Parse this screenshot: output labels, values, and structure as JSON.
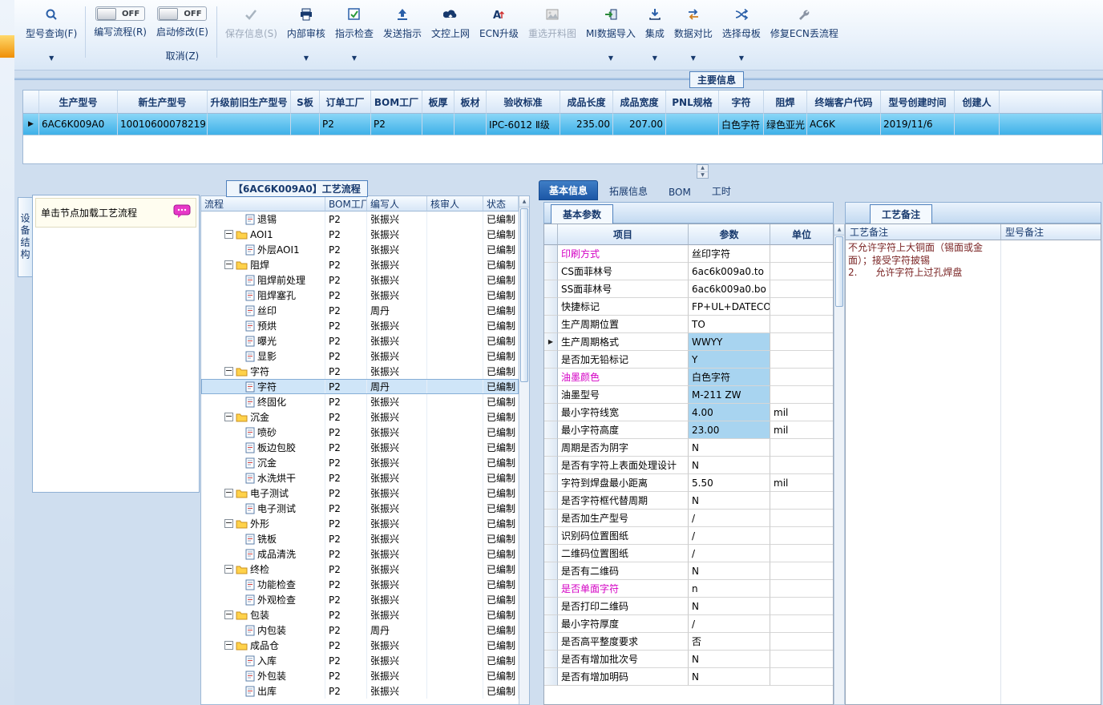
{
  "colors": {
    "accent_blue": "#1c57a6",
    "row_selection_cyan": "#4db6ec",
    "cell_highlight_blue": "#a8d4f0",
    "magenta_label": "#d400c4",
    "header_text_navy": "#17396d",
    "folder_yellow": "#ffd24a"
  },
  "toolbar": {
    "query": {
      "label": "型号查询(F)",
      "icon": "search-icon"
    },
    "write_flow": {
      "toggle": "OFF",
      "label": "编写流程(R)"
    },
    "start_edit": {
      "toggle": "OFF",
      "label": "启动修改(E)",
      "cancel": "取消(Z)"
    },
    "save": {
      "label": "保存信息(S)",
      "icon": "check-icon"
    },
    "audit": {
      "label": "内部审核",
      "icon": "printer-icon"
    },
    "inspect": {
      "label": "指示检查",
      "icon": "checkbox-icon"
    },
    "send": {
      "label": "发送指示",
      "icon": "send-up-icon"
    },
    "doc_upload": {
      "label": "文控上网",
      "icon": "cloud-upload-icon"
    },
    "ecn": {
      "label": "ECN升级",
      "icon": "ecn-upgrade-icon"
    },
    "recut": {
      "label": "重选开料图",
      "icon": "image-icon"
    },
    "mi_import": {
      "label": "MI数据导入",
      "icon": "import-icon"
    },
    "integrate": {
      "label": "集成",
      "icon": "collect-icon"
    },
    "compare": {
      "label": "数据对比",
      "icon": "compare-icon"
    },
    "mother_board": {
      "label": "选择母板",
      "icon": "shuffle-icon"
    },
    "fix_ecn": {
      "label": "修复ECN丢流程",
      "icon": "wrench-icon"
    }
  },
  "main_info": {
    "group_label": "主要信息",
    "headers": [
      "生产型号",
      "新生产型号",
      "升级前旧生产型号",
      "S板",
      "订单工厂",
      "BOM工厂",
      "板厚",
      "板材",
      "验收标准",
      "成品长度",
      "成品宽度",
      "PNL规格",
      "字符",
      "阻焊",
      "终端客户代码",
      "型号创建时间",
      "创建人"
    ],
    "row": {
      "marker": "▶",
      "model": "6AC6K009A0",
      "new_model": "10010600078219",
      "old_model": "",
      "s_version": "",
      "order_factory": "P2",
      "bom_factory": "P2",
      "thickness": "",
      "material": "",
      "standard": "IPC-6012 Ⅱ级",
      "length": "235.00",
      "width": "207.00",
      "pnl": "",
      "silk_color": "白色字符",
      "mask_color": "绿色亚光",
      "customer_code": "AC6K",
      "create_time": "2019/11/6",
      "creator": ""
    }
  },
  "structure_panel": {
    "vertical_tab": "设备结构",
    "hint": "单击节点加载工艺流程"
  },
  "flow": {
    "title": "【6AC6K009A0】工艺流程",
    "headers": [
      "流程",
      "BOM工厂",
      "编写人",
      "核审人",
      "状态"
    ],
    "rows": [
      {
        "name": "退锡",
        "bom": "P2",
        "writer": "张振兴",
        "auditor": "",
        "status": "已编制"
      },
      {
        "name": "AOI1",
        "bom": "P2",
        "writer": "张振兴",
        "auditor": "",
        "status": "已编制",
        "cls": "folder"
      },
      {
        "name": "外层AOI1",
        "bom": "P2",
        "writer": "张振兴",
        "auditor": "",
        "status": "已编制"
      },
      {
        "name": "阻焊",
        "bom": "P2",
        "writer": "张振兴",
        "auditor": "",
        "status": "已编制",
        "cls": "folder"
      },
      {
        "name": "阻焊前处理",
        "bom": "P2",
        "writer": "张振兴",
        "auditor": "",
        "status": "已编制"
      },
      {
        "name": "阻焊塞孔",
        "bom": "P2",
        "writer": "张振兴",
        "auditor": "",
        "status": "已编制"
      },
      {
        "name": "丝印",
        "bom": "P2",
        "writer": "周丹",
        "auditor": "",
        "status": "已编制"
      },
      {
        "name": "预烘",
        "bom": "P2",
        "writer": "张振兴",
        "auditor": "",
        "status": "已编制"
      },
      {
        "name": "曝光",
        "bom": "P2",
        "writer": "张振兴",
        "auditor": "",
        "status": "已编制"
      },
      {
        "name": "显影",
        "bom": "P2",
        "writer": "张振兴",
        "auditor": "",
        "status": "已编制"
      },
      {
        "name": "字符",
        "bom": "P2",
        "writer": "张振兴",
        "auditor": "",
        "status": "已编制",
        "cls": "folder"
      },
      {
        "name": "字符",
        "bom": "P2",
        "writer": "周丹",
        "auditor": "",
        "status": "已编制",
        "cls": "sel"
      },
      {
        "name": "终固化",
        "bom": "P2",
        "writer": "张振兴",
        "auditor": "",
        "status": "已编制"
      },
      {
        "name": "沉金",
        "bom": "P2",
        "writer": "张振兴",
        "auditor": "",
        "status": "已编制",
        "cls": "folder"
      },
      {
        "name": "喷砂",
        "bom": "P2",
        "writer": "张振兴",
        "auditor": "",
        "status": "已编制"
      },
      {
        "name": "板边包胶",
        "bom": "P2",
        "writer": "张振兴",
        "auditor": "",
        "status": "已编制"
      },
      {
        "name": "沉金",
        "bom": "P2",
        "writer": "张振兴",
        "auditor": "",
        "status": "已编制"
      },
      {
        "name": "水洗烘干",
        "bom": "P2",
        "writer": "张振兴",
        "auditor": "",
        "status": "已编制"
      },
      {
        "name": "电子测试",
        "bom": "P2",
        "writer": "张振兴",
        "auditor": "",
        "status": "已编制",
        "cls": "folder"
      },
      {
        "name": "电子测试",
        "bom": "P2",
        "writer": "张振兴",
        "auditor": "",
        "status": "已编制"
      },
      {
        "name": "外形",
        "bom": "P2",
        "writer": "张振兴",
        "auditor": "",
        "status": "已编制",
        "cls": "folder"
      },
      {
        "name": "铣板",
        "bom": "P2",
        "writer": "张振兴",
        "auditor": "",
        "status": "已编制"
      },
      {
        "name": "成品清洗",
        "bom": "P2",
        "writer": "张振兴",
        "auditor": "",
        "status": "已编制"
      },
      {
        "name": "终检",
        "bom": "P2",
        "writer": "张振兴",
        "auditor": "",
        "status": "已编制",
        "cls": "folder"
      },
      {
        "name": "功能检查",
        "bom": "P2",
        "writer": "张振兴",
        "auditor": "",
        "status": "已编制"
      },
      {
        "name": "外观检查",
        "bom": "P2",
        "writer": "张振兴",
        "auditor": "",
        "status": "已编制"
      },
      {
        "name": "包装",
        "bom": "P2",
        "writer": "张振兴",
        "auditor": "",
        "status": "已编制",
        "cls": "folder"
      },
      {
        "name": "内包装",
        "bom": "P2",
        "writer": "周丹",
        "auditor": "",
        "status": "已编制"
      },
      {
        "name": "成品仓",
        "bom": "P2",
        "writer": "张振兴",
        "auditor": "",
        "status": "已编制",
        "cls": "folder"
      },
      {
        "name": "入库",
        "bom": "P2",
        "writer": "张振兴",
        "auditor": "",
        "status": "已编制"
      },
      {
        "name": "外包装",
        "bom": "P2",
        "writer": "张振兴",
        "auditor": "",
        "status": "已编制"
      },
      {
        "name": "出库",
        "bom": "P2",
        "writer": "张振兴",
        "auditor": "",
        "status": "已编制"
      }
    ]
  },
  "detail": {
    "tabs": [
      "基本信息",
      "拓展信息",
      "BOM",
      "工时"
    ],
    "active_tab": "基本信息",
    "params_group": "基本参数",
    "param_headers": [
      "项目",
      "参数",
      "单位"
    ],
    "params": [
      {
        "name": "印刷方式",
        "value": "丝印字符",
        "unit": "",
        "ncls": "pink"
      },
      {
        "name": "CS面菲林号",
        "value": "6ac6k009a0.to",
        "unit": ""
      },
      {
        "name": "SS面菲林号",
        "value": "6ac6k009a0.bo",
        "unit": ""
      },
      {
        "name": "快捷标记",
        "value": "FP+UL+DATECODE",
        "unit": ""
      },
      {
        "name": "生产周期位置",
        "value": "TO",
        "unit": ""
      },
      {
        "name": "生产周期格式",
        "value": "WWYY",
        "unit": "",
        "vcls": "hl",
        "mk": "▶"
      },
      {
        "name": "是否加无铅标记",
        "value": "Y",
        "unit": "",
        "vcls": "hl"
      },
      {
        "name": "油墨颜色",
        "value": "白色字符",
        "unit": "",
        "ncls": "pink",
        "vcls": "hl"
      },
      {
        "name": "油墨型号",
        "value": "M-211 ZW",
        "unit": "",
        "vcls": "hl"
      },
      {
        "name": "最小字符线宽",
        "value": "4.00",
        "unit": "mil",
        "vcls": "hl"
      },
      {
        "name": "最小字符高度",
        "value": "23.00",
        "unit": "mil",
        "vcls": "hl"
      },
      {
        "name": "周期是否为阴字",
        "value": "N",
        "unit": ""
      },
      {
        "name": "是否有字符上表面处理设计",
        "value": "N",
        "unit": ""
      },
      {
        "name": "字符到焊盘最小距离",
        "value": "5.50",
        "unit": "mil"
      },
      {
        "name": "是否字符框代替周期",
        "value": "N",
        "unit": ""
      },
      {
        "name": "是否加生产型号",
        "value": "/",
        "unit": ""
      },
      {
        "name": "识别码位置图纸",
        "value": "/",
        "unit": ""
      },
      {
        "name": "二维码位置图纸",
        "value": "/",
        "unit": ""
      },
      {
        "name": "是否有二维码",
        "value": "N",
        "unit": ""
      },
      {
        "name": "是否单面字符",
        "value": "n",
        "unit": "",
        "ncls": "pink"
      },
      {
        "name": "是否打印二维码",
        "value": "N",
        "unit": ""
      },
      {
        "name": "最小字符厚度",
        "value": "/",
        "unit": ""
      },
      {
        "name": "是否高平整度要求",
        "value": "否",
        "unit": ""
      },
      {
        "name": "是否有增加批次号",
        "value": "N",
        "unit": ""
      },
      {
        "name": "是否有增加明码",
        "value": "N",
        "unit": ""
      }
    ],
    "notes_group": "工艺备注",
    "note_headers": [
      "工艺备注",
      "型号备注"
    ],
    "process_note": "不允许字符上大铜面（锡面或金面）；接受字符披锡\n2.      允许字符上过孔焊盘",
    "model_note": ""
  }
}
